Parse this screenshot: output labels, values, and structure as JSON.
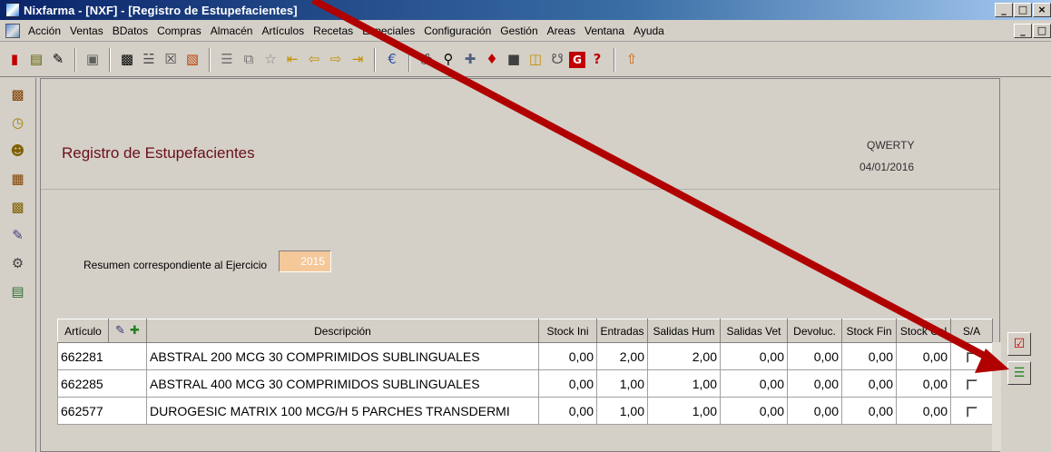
{
  "window": {
    "title": "Nixfarma - [NXF] - [Registro de Estupefacientes]",
    "buttons": [
      "_",
      "□",
      "×"
    ]
  },
  "menu": {
    "items": [
      "Acción",
      "Ventas",
      "BDatos",
      "Compras",
      "Almacén",
      "Artículos",
      "Recetas",
      "Especiales",
      "Configuración",
      "Gestión",
      "Areas",
      "Ventana",
      "Ayuda"
    ]
  },
  "toolbar": {
    "icons": [
      "exit-icon",
      "notes-icon",
      "edit-icon",
      "calendar-icon",
      "search-icon",
      "print-icon",
      "delete-icon",
      "filter-icon",
      "list-icon",
      "copy-icon",
      "star-icon",
      "first-icon",
      "prev-icon",
      "next-icon",
      "last-icon",
      "euro-icon",
      "printer-icon",
      "preview-icon",
      "medic-icon",
      "cart-icon",
      "block-icon",
      "monitor-icon",
      "basket-icon",
      "g-icon",
      "help-icon",
      "upload-icon"
    ]
  },
  "form": {
    "title": "Registro de Estupefacientes",
    "user": "QWERTY",
    "date": "04/01/2016",
    "resumen_label": "Resumen correspondiente al Ejercicio",
    "ejercicio": "2015"
  },
  "grid": {
    "columns": [
      "Artículo",
      "Descripción",
      "Stock Ini",
      "Entradas",
      "Salidas Hum",
      "Salidas Vet",
      "Devoluc.",
      "Stock Fin",
      "Stock Cal",
      "S/A"
    ],
    "rows": [
      {
        "articulo": "662281",
        "descripcion": "ABSTRAL 200 MCG 30 COMPRIMIDOS SUBLINGUALES",
        "stock_ini": "0,00",
        "entradas": "2,00",
        "salidas_hum": "2,00",
        "salidas_vet": "0,00",
        "devoluc": "0,00",
        "stock_fin": "0,00",
        "stock_cal": "0,00",
        "sa": false
      },
      {
        "articulo": "662285",
        "descripcion": "ABSTRAL 400 MCG 30 COMPRIMIDOS SUBLINGUALES",
        "stock_ini": "0,00",
        "entradas": "1,00",
        "salidas_hum": "1,00",
        "salidas_vet": "0,00",
        "devoluc": "0,00",
        "stock_fin": "0,00",
        "stock_cal": "0,00",
        "sa": false
      },
      {
        "articulo": "662577",
        "descripcion": "DUROGESIC MATRIX 100 MCG/H 5 PARCHES TRANSDERMI",
        "stock_ini": "0,00",
        "entradas": "1,00",
        "salidas_hum": "1,00",
        "salidas_vet": "0,00",
        "devoluc": "0,00",
        "stock_fin": "0,00",
        "stock_cal": "0,00",
        "sa": false
      }
    ]
  },
  "colors": {
    "title": "#6b0f1a",
    "annotation_arrow": "#b00000",
    "ejercicio_bg": "#f5c89a"
  }
}
